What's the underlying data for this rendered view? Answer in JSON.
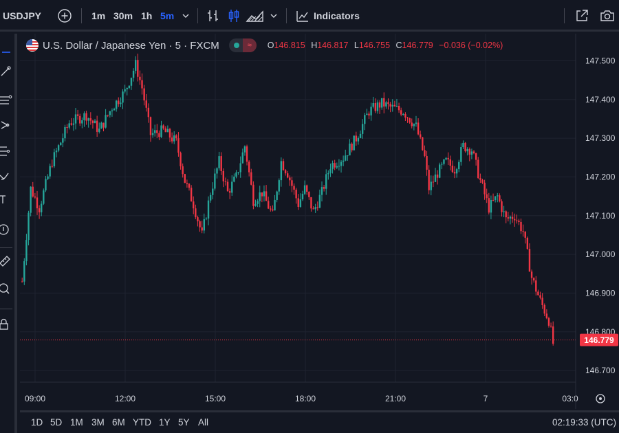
{
  "toolbar": {
    "symbol": "USDJPY",
    "intervals": [
      {
        "label": "1m",
        "active": false
      },
      {
        "label": "30m",
        "active": false
      },
      {
        "label": "1h",
        "active": false
      },
      {
        "label": "5m",
        "active": true
      }
    ],
    "indicators_label": "Indicators",
    "accent_color": "#2962ff"
  },
  "legend": {
    "title": "U.S. Dollar / Japanese Yen · 5 · FXCM",
    "ohlc": [
      {
        "label": "O",
        "value": "146.815"
      },
      {
        "label": "H",
        "value": "146.817"
      },
      {
        "label": "L",
        "value": "146.755"
      },
      {
        "label": "C",
        "value": "146.779"
      }
    ],
    "change": "−0.036 (−0.02%)",
    "down_color": "#f23645",
    "up_color": "#26a69a"
  },
  "chart_data": {
    "type": "candlestick",
    "price_axis": [
      "147.500",
      "147.400",
      "147.300",
      "147.200",
      "147.100",
      "147.000",
      "146.900",
      "146.800",
      "146.700"
    ],
    "ylim": [
      146.67,
      147.57
    ],
    "time_axis": [
      "09:00",
      "12:00",
      "15:00",
      "18:00",
      "21:00",
      "7",
      "03:0"
    ],
    "last_price": "146.779",
    "path": [
      [
        0.0,
        146.93
      ],
      [
        4.0,
        147.17
      ],
      [
        8.0,
        147.12
      ],
      [
        14.0,
        147.24
      ],
      [
        22.0,
        147.34
      ],
      [
        30.0,
        147.36
      ],
      [
        36.0,
        147.32
      ],
      [
        42.0,
        147.38
      ],
      [
        48.0,
        147.42
      ],
      [
        53.0,
        147.49
      ],
      [
        56.0,
        147.43
      ],
      [
        60.0,
        147.31
      ],
      [
        66.0,
        147.32
      ],
      [
        72.0,
        147.29
      ],
      [
        76.0,
        147.19
      ],
      [
        80.0,
        147.13
      ],
      [
        84.0,
        147.05
      ],
      [
        88.0,
        147.16
      ],
      [
        92.0,
        147.24
      ],
      [
        96.0,
        147.16
      ],
      [
        100.0,
        147.2
      ],
      [
        104.0,
        147.28
      ],
      [
        108.0,
        147.14
      ],
      [
        112.0,
        147.16
      ],
      [
        117.0,
        147.1
      ],
      [
        121.0,
        147.24
      ],
      [
        124.0,
        147.21
      ],
      [
        129.0,
        147.13
      ],
      [
        132.0,
        147.17
      ],
      [
        136.0,
        147.11
      ],
      [
        140.0,
        147.16
      ],
      [
        144.0,
        147.23
      ],
      [
        150.0,
        147.25
      ],
      [
        156.0,
        147.3
      ],
      [
        162.0,
        147.37
      ],
      [
        168.0,
        147.39
      ],
      [
        172.0,
        147.38
      ],
      [
        178.0,
        147.37
      ],
      [
        184.0,
        147.33
      ],
      [
        188.0,
        147.25
      ],
      [
        190.0,
        147.17
      ],
      [
        194.0,
        147.21
      ],
      [
        198.0,
        147.24
      ],
      [
        202.0,
        147.22
      ],
      [
        206.0,
        147.28
      ],
      [
        210.0,
        147.27
      ],
      [
        214.0,
        147.19
      ],
      [
        218.0,
        147.12
      ],
      [
        222.0,
        147.15
      ],
      [
        226.0,
        147.09
      ],
      [
        230.0,
        147.1
      ],
      [
        234.0,
        147.06
      ],
      [
        238.0,
        146.94
      ],
      [
        242.0,
        146.88
      ],
      [
        246.0,
        146.83
      ],
      [
        248.0,
        146.77
      ]
    ]
  },
  "bottom": {
    "ranges": [
      "1D",
      "5D",
      "1M",
      "3M",
      "6M",
      "YTD",
      "1Y",
      "5Y",
      "All"
    ],
    "clock": "02:19:33 (UTC)"
  }
}
